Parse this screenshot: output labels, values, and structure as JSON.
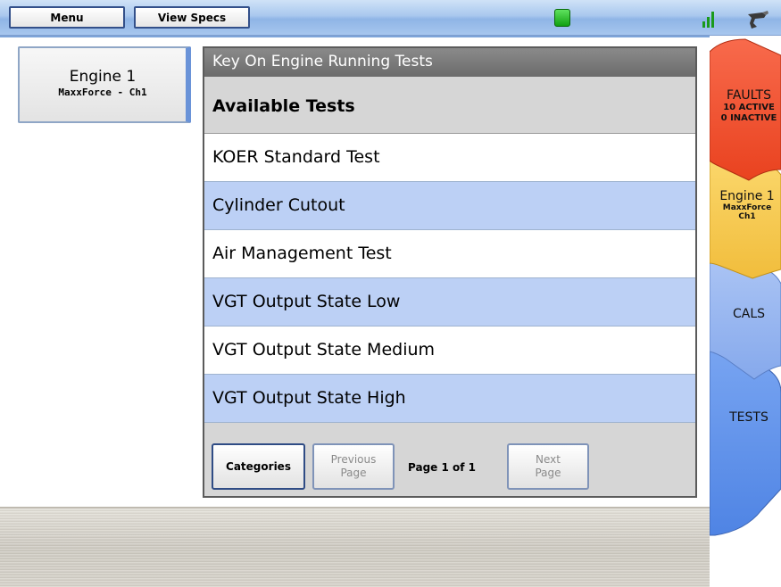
{
  "toolbar": {
    "menu_label": "Menu",
    "specs_label": "View Specs",
    "status_color": "#22b822"
  },
  "engine_tab": {
    "title": "Engine 1",
    "subtitle": "MaxxForce - Ch1"
  },
  "panel": {
    "header": "Key On Engine Running Tests",
    "subheader": "Available Tests",
    "tests": [
      "KOER Standard Test",
      "Cylinder Cutout",
      "Air Management Test",
      "VGT Output State Low",
      "VGT Output State Medium",
      "VGT Output State High"
    ],
    "footer": {
      "categories_label": "Categories",
      "prev_line1": "Previous",
      "prev_line2": "Page",
      "page_text": "Page 1 of 1",
      "next_line1": "Next",
      "next_line2": "Page"
    }
  },
  "side_tabs": {
    "faults": {
      "label": "FAULTS",
      "active": "10 ACTIVE",
      "inactive": "0 INACTIVE",
      "color": "#f04e2e"
    },
    "engine": {
      "label": "Engine 1",
      "line1": "MaxxForce",
      "line2": "Ch1",
      "color": "#f5c94a"
    },
    "cals": {
      "label": "CALS",
      "color": "#8fb0f0"
    },
    "tests": {
      "label": "TESTS",
      "color": "#5f92ea"
    }
  }
}
